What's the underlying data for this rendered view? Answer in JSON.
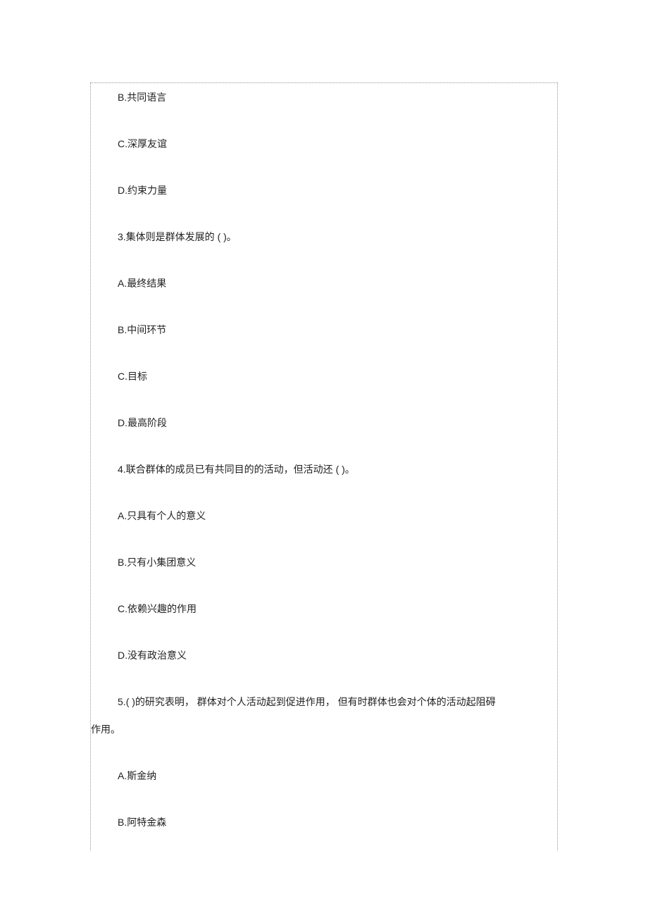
{
  "options_block1": {
    "b": {
      "prefix": "B.",
      "text": "共同语言"
    },
    "c": {
      "prefix": "C.",
      "text": "深厚友谊"
    },
    "d": {
      "prefix": "D.",
      "text": "约束力量"
    }
  },
  "question3": {
    "number": "3.",
    "text": "集体则是群体发展的    (  )。",
    "a": {
      "prefix": "A.",
      "text": "最终结果"
    },
    "b": {
      "prefix": "B.",
      "text": "中间环节"
    },
    "c": {
      "prefix": "C.",
      "text": "目标"
    },
    "d": {
      "prefix": "D.",
      "text": "最高阶段"
    }
  },
  "question4": {
    "number": "4.",
    "text": "联合群体的成员已有共同目的的活动，但活动还       (  )。",
    "a": {
      "prefix": "A.",
      "text": "只具有个人的意义"
    },
    "b": {
      "prefix": "B.",
      "text": "只有小集团意义"
    },
    "c": {
      "prefix": "C.",
      "text": "依赖兴趣的作用"
    },
    "d": {
      "prefix": "D.",
      "text": "没有政治意义"
    }
  },
  "question5": {
    "number": "5.",
    "text_part1": "(  )的研究表明，    群体对个人活动起到促进作用，     但有时群体也会对个体的活动起阻碍",
    "text_part2": "作用。",
    "a": {
      "prefix": "A.",
      "text": "斯金纳"
    },
    "b": {
      "prefix": "B.",
      "text": "阿特金森"
    }
  }
}
